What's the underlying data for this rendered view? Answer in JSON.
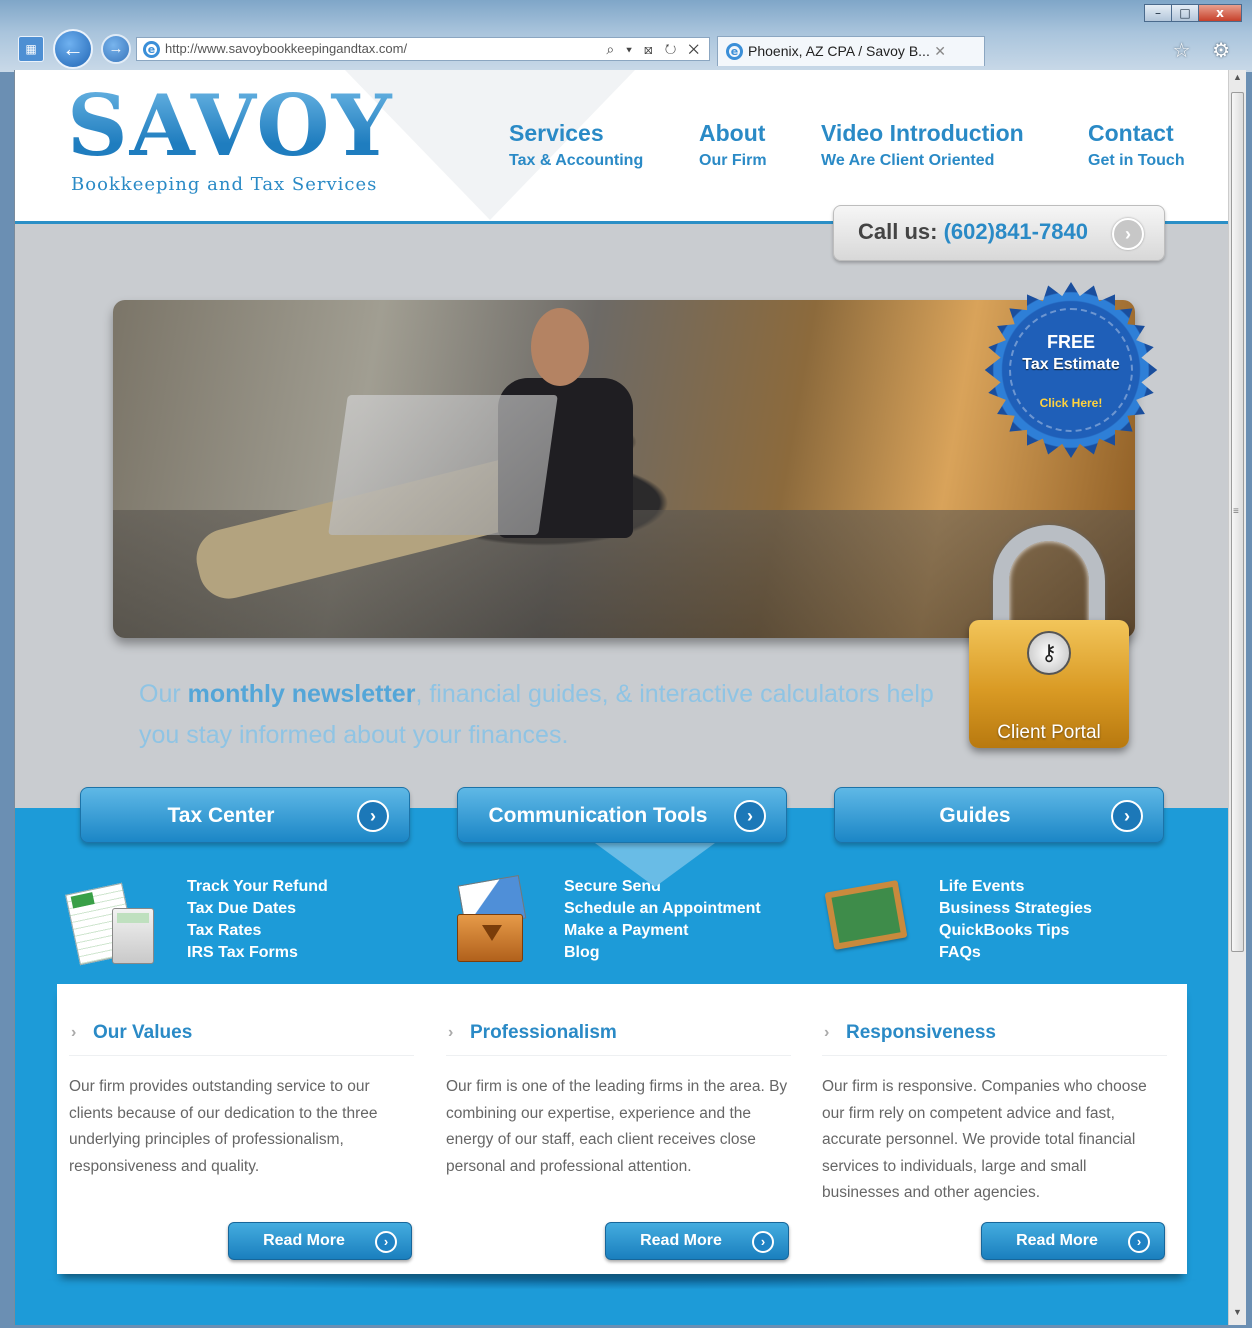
{
  "browser": {
    "url": "http://www.savoybookkeepingandtax.com/",
    "tab_title": "Phoenix, AZ CPA / Savoy B...",
    "window_buttons": [
      "–",
      "□",
      "x"
    ],
    "addr_tools": "⌕ ▾ ⊠ ↻ ✕",
    "right_icons": "☆ ⚙"
  },
  "header": {
    "logo_word": "SAVOY",
    "logo_tagline": "Bookkeeping and Tax Services",
    "nav": [
      {
        "title": "Services",
        "subtitle": "Tax & Accounting"
      },
      {
        "title": "About",
        "subtitle": "Our Firm"
      },
      {
        "title": "Video Introduction",
        "subtitle": "We Are Client Oriented"
      },
      {
        "title": "Contact",
        "subtitle": "Get in Touch"
      }
    ],
    "call_label": "Call us:",
    "call_number": "(602)841-7840"
  },
  "badge": {
    "line1": "FREE",
    "line2": "Tax Estimate",
    "line3": "Click Here!"
  },
  "client_portal": "Client Portal",
  "tagline": {
    "part1": "Our ",
    "bold": "monthly newsletter",
    "part2": ", financial guides, & interactive calculators help you stay informed about your finances."
  },
  "tabs": [
    {
      "label": "Tax Center",
      "links": [
        "Track Your Refund",
        "Tax Due Dates",
        "Tax Rates",
        "IRS Tax Forms"
      ]
    },
    {
      "label": "Communication Tools",
      "links": [
        "Secure Send",
        "Schedule an Appointment",
        "Make a Payment",
        "Blog"
      ]
    },
    {
      "label": "Guides",
      "links": [
        "Life Events",
        "Business Strategies",
        "QuickBooks Tips",
        "FAQs"
      ]
    }
  ],
  "columns": [
    {
      "heading": "Our Values",
      "text": "Our firm provides outstanding service to our clients because of our dedication to the three underlying principles of professionalism, responsiveness and quality.",
      "button": "Read More"
    },
    {
      "heading": "Professionalism",
      "text": "Our firm is one of the leading firms in the area. By combining our expertise, experience and the energy of our staff, each client receives close personal and professional attention.",
      "button": "Read More"
    },
    {
      "heading": "Responsiveness",
      "text": "Our firm is responsive. Companies who choose our firm rely on competent advice and fast, accurate personnel. We provide total financial services to individuals, large and small businesses and other agencies.",
      "button": "Read More"
    }
  ],
  "colors": {
    "brand_blue": "#2a8ac6",
    "band_blue": "#1d9bd8",
    "badge_blue": "#1f5fb8",
    "lock_gold": "#d99a24"
  }
}
